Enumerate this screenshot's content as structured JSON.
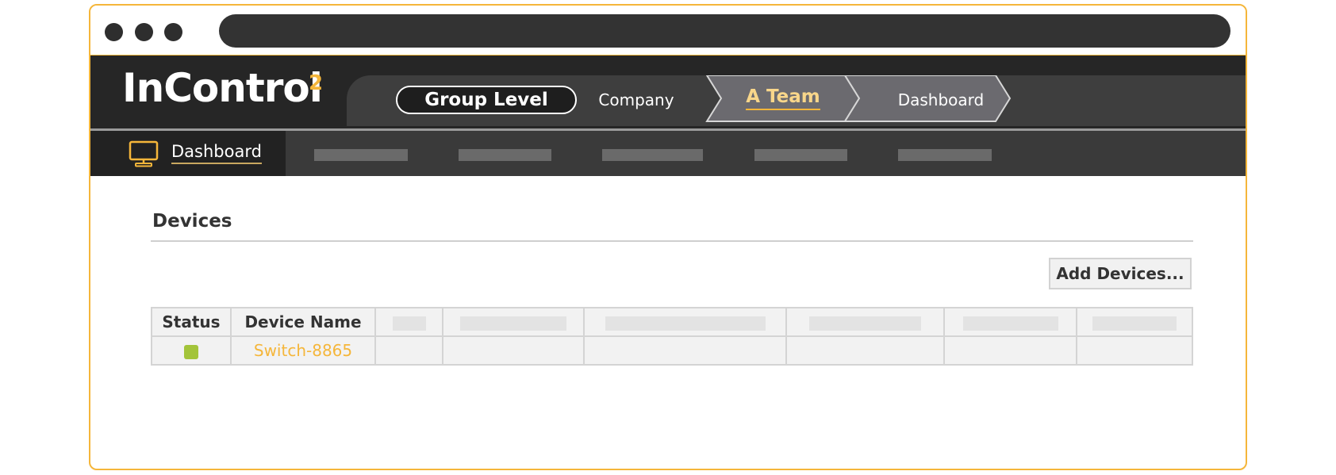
{
  "app": {
    "logo_text": "InControl",
    "logo_superscript": "2"
  },
  "breadcrumb": {
    "items": [
      {
        "label": "Group Level"
      },
      {
        "label": "Company"
      },
      {
        "label": "A Team"
      },
      {
        "label": "Dashboard"
      }
    ]
  },
  "nav": {
    "active_label": "Dashboard",
    "active_icon": "monitor-icon"
  },
  "devices": {
    "title": "Devices",
    "add_button_label": "Add Devices...",
    "columns": [
      "Status",
      "Device Name"
    ],
    "rows": [
      {
        "status": "online",
        "status_color": "#a3c43a",
        "device_name": "Switch-8865"
      }
    ]
  },
  "colors": {
    "accent": "#f5b63a",
    "status_online": "#a3c43a"
  }
}
